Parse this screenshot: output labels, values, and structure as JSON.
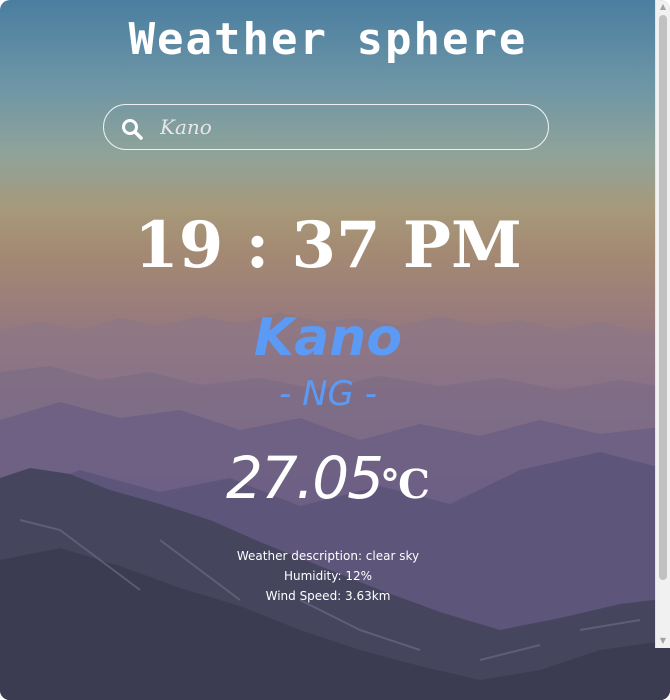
{
  "app": {
    "title": "Weather sphere"
  },
  "search": {
    "value": "Kano",
    "placeholder": "Kano",
    "icon": "search-icon"
  },
  "time": {
    "hours": "19",
    "separator": ":",
    "minutes": "37",
    "period": "PM"
  },
  "location": {
    "city": "Kano",
    "country": "- NG -"
  },
  "weather": {
    "temperature": "27.05",
    "unit": "℃",
    "description": "Weather description: clear sky",
    "humidity": "Humidity: 12%",
    "wind": "Wind Speed: 3.63km"
  },
  "colors": {
    "accent": "#5b9bf5",
    "text": "#ffffff"
  }
}
